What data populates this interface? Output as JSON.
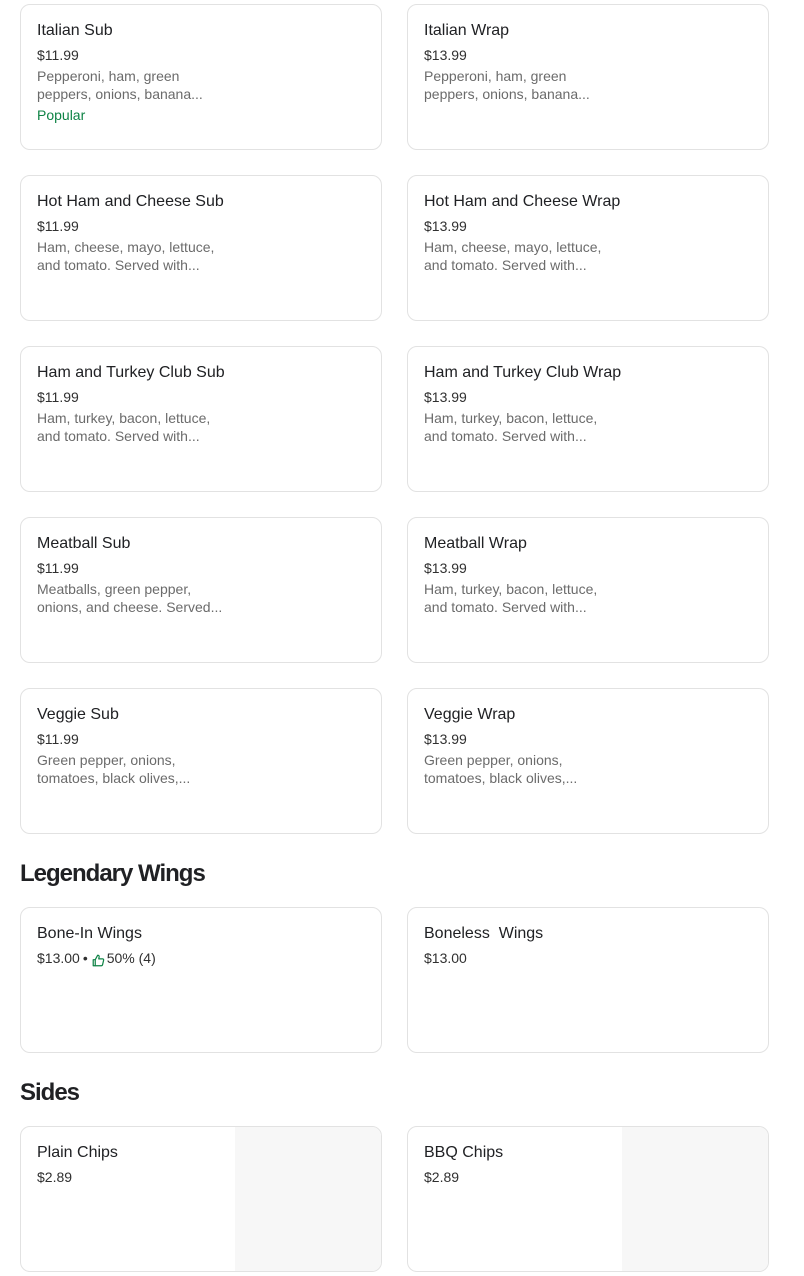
{
  "items": {
    "italian_sub": {
      "name": "Italian Sub",
      "price": "$11.99",
      "description": "Pepperoni, ham, green peppers, onions, banana...",
      "badge": "Popular"
    },
    "italian_wrap": {
      "name": "Italian Wrap",
      "price": "$13.99",
      "description": "Pepperoni, ham, green peppers, onions, banana..."
    },
    "hot_ham_sub": {
      "name": "Hot Ham and Cheese Sub",
      "price": "$11.99",
      "description": "Ham, cheese, mayo, lettuce, and tomato. Served with..."
    },
    "hot_ham_wrap": {
      "name": "Hot Ham and Cheese Wrap",
      "price": "$13.99",
      "description": "Ham, cheese, mayo, lettuce, and tomato. Served with..."
    },
    "club_sub": {
      "name": "Ham and Turkey Club Sub",
      "price": "$11.99",
      "description": "Ham, turkey, bacon, lettuce, and tomato. Served with..."
    },
    "club_wrap": {
      "name": "Ham and Turkey Club Wrap",
      "price": "$13.99",
      "description": "Ham, turkey, bacon, lettuce, and tomato. Served with..."
    },
    "meatball_sub": {
      "name": "Meatball Sub",
      "price": "$11.99",
      "description": "Meatballs, green pepper, onions, and cheese. Served..."
    },
    "meatball_wrap": {
      "name": "Meatball Wrap",
      "price": "$13.99",
      "description": "Ham, turkey, bacon, lettuce, and tomato. Served with..."
    },
    "veggie_sub": {
      "name": "Veggie Sub",
      "price": "$11.99",
      "description": "Green pepper, onions, tomatoes, black olives,..."
    },
    "veggie_wrap": {
      "name": "Veggie Wrap",
      "price": "$13.99",
      "description": "Green pepper, onions, tomatoes, black olives,..."
    }
  },
  "sections": {
    "wings": {
      "title": "Legendary Wings",
      "bone_in": {
        "name": "Bone-In Wings",
        "price": "$13.00",
        "separator": "•",
        "rating": "50% (4)",
        "icon": "thumbs-up-icon"
      },
      "boneless": {
        "name": "Boneless  Wings",
        "price": "$13.00"
      }
    },
    "sides": {
      "title": "Sides",
      "plain_chips": {
        "name": "Plain Chips",
        "price": "$2.89"
      },
      "bbq_chips": {
        "name": "BBQ Chips",
        "price": "$2.89"
      }
    }
  },
  "colors": {
    "badge": "#0e8345",
    "rating_icon": "#0e8345",
    "card_border": "#e2e2e2",
    "image_placeholder": "#f7f7f7"
  }
}
